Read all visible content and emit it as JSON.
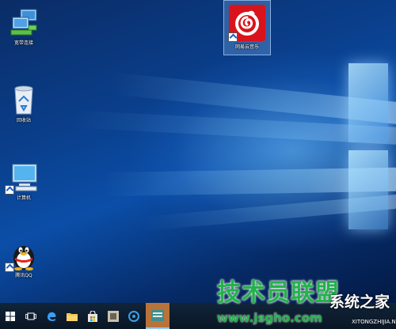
{
  "desktop_icons": [
    {
      "label": "宽带连接",
      "icon": "network-computers-icon"
    },
    {
      "label": "回收站",
      "icon": "recycle-bin-icon"
    },
    {
      "label": "计算机",
      "icon": "monitor-icon"
    },
    {
      "label": "腾讯QQ",
      "icon": "qq-penguin-icon"
    },
    {
      "label": "网易云音乐",
      "icon": "netease-music-icon"
    }
  ],
  "taskbar": {
    "items": [
      "start",
      "task-view",
      "edge",
      "file-explorer",
      "store",
      "app",
      "app",
      "app-active"
    ]
  },
  "watermark": {
    "brand": "技术员联盟",
    "url": "www.jsgho.com",
    "site": "系统之家",
    "tag": "XITONGZHIJIA.NET"
  },
  "colors": {
    "accent": "#23b24b",
    "taskbar": "#0f2133",
    "wallpaper": "#0b4ea8"
  }
}
